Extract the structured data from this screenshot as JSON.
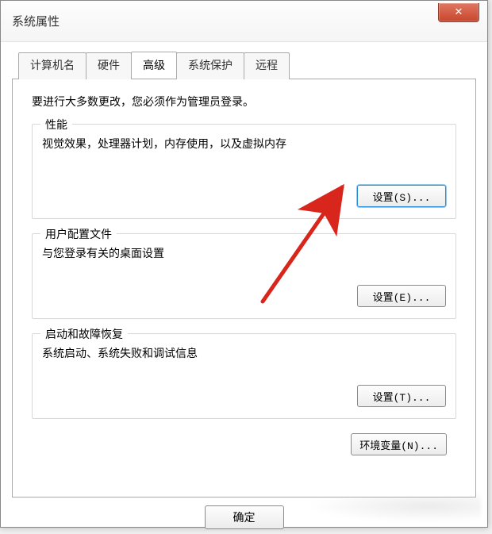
{
  "window": {
    "title": "系统属性"
  },
  "tabs": {
    "computer_name": "计算机名",
    "hardware": "硬件",
    "advanced": "高级",
    "system_protection": "系统保护",
    "remote": "远程"
  },
  "panel": {
    "admin_note": "要进行大多数更改，您必须作为管理员登录。",
    "performance": {
      "title": "性能",
      "desc": "视觉效果，处理器计划，内存使用，以及虚拟内存",
      "button": "设置(S)..."
    },
    "profiles": {
      "title": "用户配置文件",
      "desc": "与您登录有关的桌面设置",
      "button": "设置(E)..."
    },
    "startup": {
      "title": "启动和故障恢复",
      "desc": "系统启动、系统失败和调试信息",
      "button": "设置(T)..."
    },
    "env_button": "环境变量(N)..."
  },
  "footer": {
    "ok": "确定"
  },
  "icons": {
    "close": "✕"
  }
}
